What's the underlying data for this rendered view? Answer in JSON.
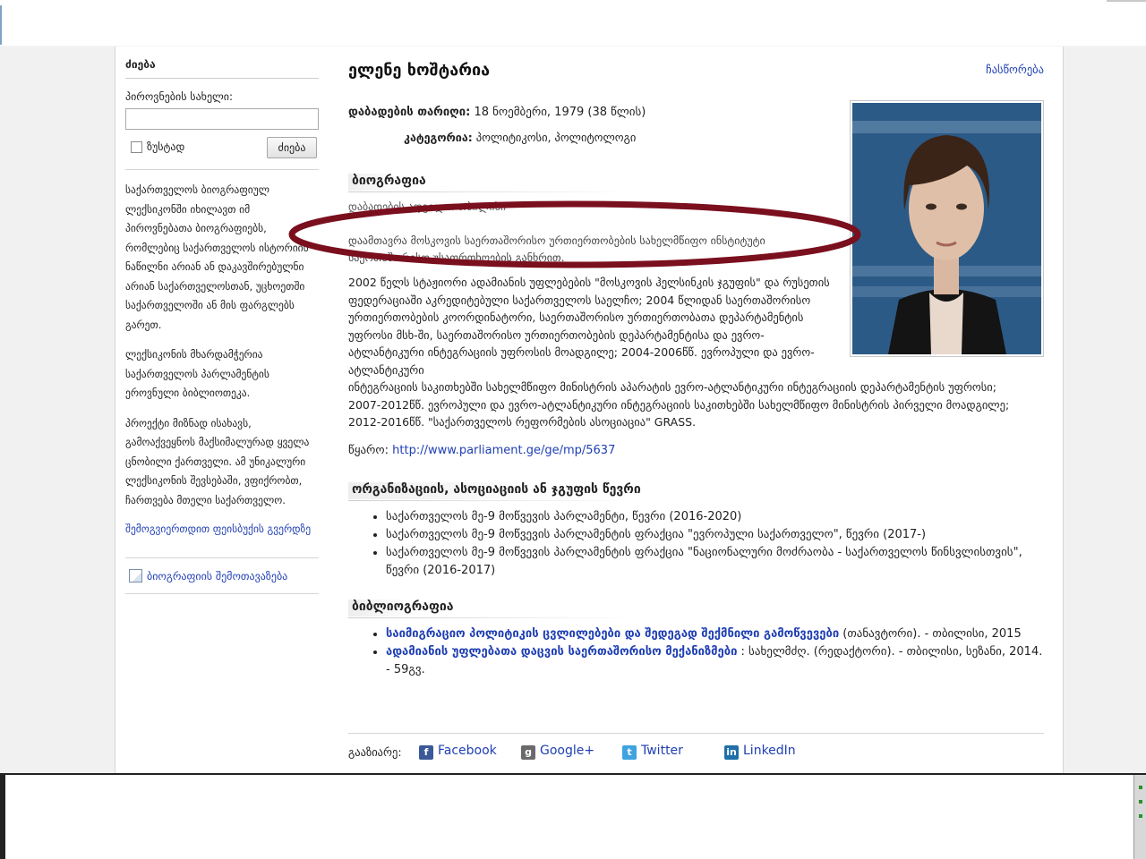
{
  "sidebar": {
    "title": "ძიება",
    "name_label": "პიროვნების სახელი:",
    "exact_label": "ზუსტად",
    "search_button": "ძიება",
    "about_paragraphs": [
      "საქართველოს ბიოგრაფიულ ლექსიკონში იხილავთ იმ პიროვნებათა ბიოგრაფიებს, რომლებიც საქართველოს ისტორიის ნაწილნი არიან ან დაკავშირებულნი არიან საქართველოსთან, უცხოეთში საქართველოში ან მის ფარგლებს გარეთ.",
      "ლექსიკონის მხარდამჭერია საქართველოს პარლამენტის ეროვნული ბიბლიოთეკა.",
      "პროექტი მიზნად ისახავს, გამოაქვეყნოს მაქსიმალურად ყველა ცნობილი ქართველი. ამ უნიკალური ლექსიკონის შევსებაში, ვფიქრობთ, ჩართვება მთელი საქართველო."
    ],
    "facebook_link": "შემოგვიერთდით ფეისბუქის გვერდზე",
    "suggest_link": "ბიოგრაფიის შემოთავაზება"
  },
  "main": {
    "title": "ელენე ხოშტარია",
    "edit_link": "ჩასწორება",
    "birth_label": "დაბადების თარიღი:",
    "birth_value": "18 ნოემბერი, 1979  (38 წლის)",
    "category_label": "კატეგორია:",
    "category_value": "პოლიტიკოსი, პოლიტოლოგი",
    "bio_heading": "ბიოგრაფია",
    "bio_faint": "დაბადების ადგილი: თბილისი",
    "bio_oval_text": "დაამთავრა მოსკოვის საერთაშორისო ურთიერთობების სახელმწიფო ინსტიტუტი საერთაშორისო უსაფრთხოების განხრით.",
    "bio_main_pre": "2002 წელს სტაჟიორი ადამიანის უფლებების \"მოსკოვის ჰელსინკის ჯგუფის\" და რუსეთის ფედერაციაში აკრედიტებული საქართველოს საელჩო; 2004 წლიდან საერთაშორისო ურთიერთობების კოორდინატორი, საერთაშორისო ურთიერთობათა დეპარტამენტის უფროსი მსხ-ში, საერთაშორისო ურთიერთობების დეპარტამენტისა და ევრო-ატლანტიკური ინტეგრაციის უფროსის მოადგილე; 2004-2006წწ. ევროპული და ევრო-ატლანტიკური",
    "bio_main_rest": "ინტეგრაციის საკითხებში სახელმწიფო მინისტრის აპარატის ევრო-ატლანტიკური ინტეგრაციის დეპარტამენტის უფროსი; 2007-2012წწ. ევროპული და ევრო-ატლანტიკური ინტეგრაციის საკითხებში სახელმწიფო მინისტრის პირველი მოადგილე; 2012-2016წწ. \"საქართველოს რეფორმების ასოციაცია\" GRASS.",
    "source_label": "წყარო:",
    "source_url": "http://www.parliament.ge/ge/mp/5637",
    "org_heading": "ორგანიზაციის, ასოციაციის ან ჯგუფის წევრი",
    "org_items": [
      "საქართველოს მე-9 მოწვევის პარლამენტი, წევრი (2016-2020)",
      "საქართველოს მე-9 მოწვევის პარლამენტის ფრაქცია \"ევროპული საქართველო\", წევრი (2017-)",
      "საქართველოს მე-9 მოწვევის პარლამენტის ფრაქცია \"ნაციონალური მოძრაობა - საქართველოს წინსვლისთვის\", წევრი (2016-2017)"
    ],
    "bib_heading": "ბიბლიოგრაფია",
    "bib_items": [
      {
        "title": "საიმიგრაციო პოლიტიკის ცვლილებები და შედეგად შექმნილი გამოწვევები",
        "rest": " (თანავტორი). - თბილისი, 2015"
      },
      {
        "title": "ადამიანის უფლებათა დაცვის საერთაშორისო მექანიზმები",
        "rest": " : სახელმძღ. (რედაქტორი). - თბილისი, სეზანი, 2014. - 59გვ."
      }
    ],
    "share_label": "გააზიარე:",
    "share": [
      {
        "name": "Facebook",
        "icon": "facebook-icon",
        "glyph": "f",
        "color": "#3b5998"
      },
      {
        "name": "Google+",
        "icon": "google-plus-icon",
        "glyph": "g",
        "color": "#6a6a6a"
      },
      {
        "name": "Twitter",
        "icon": "twitter-icon",
        "glyph": "t",
        "color": "#3fa3e0"
      },
      {
        "name": "LinkedIn",
        "icon": "linkedin-icon",
        "glyph": "in",
        "color": "#1f6fa8"
      }
    ]
  },
  "colors": {
    "link": "#1f3fb3",
    "annotation_oval": "#7a0f1e",
    "photo_backdrop": "#2c5a86"
  }
}
